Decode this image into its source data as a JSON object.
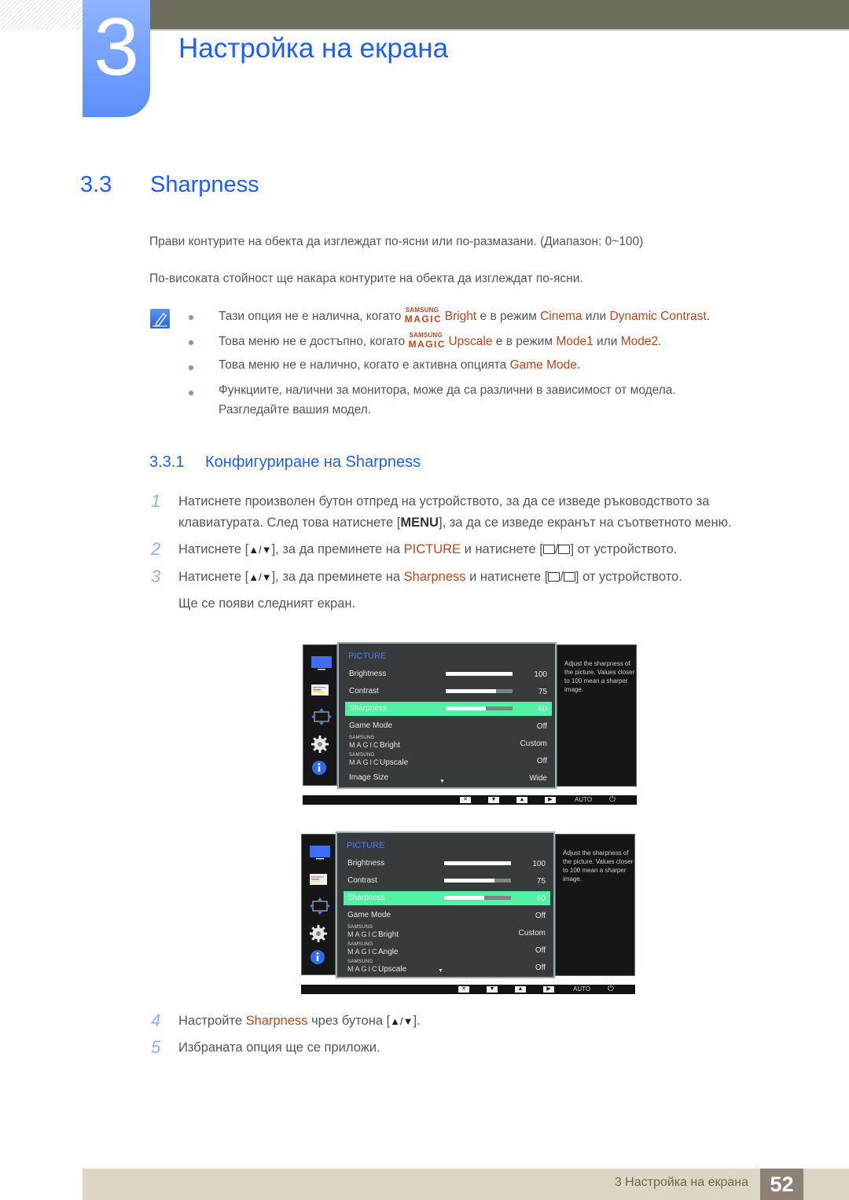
{
  "header": {
    "chapter_number": "3",
    "chapter_title": "Настройка на екрана"
  },
  "section": {
    "number": "3.3",
    "title": "Sharpness"
  },
  "intro": [
    "Прави контурите на обекта да изглеждат по-ясни или по-размазани. (Диапазон: 0~100)",
    "По-високата стойност ще накара контурите на обекта да изглеждат по-ясни."
  ],
  "notes": [
    {
      "pre": "Тази опция не е налична, когато ",
      "magic_top": "SAMSUNG",
      "magic_bottom": "MAGIC",
      "magic_word": "Bright",
      "mid": " е в режим ",
      "hl1": "Cinema",
      "mid2": " или ",
      "hl2": "Dynamic Contrast",
      "post": "."
    },
    {
      "pre": "Това меню не е достъпно, когато ",
      "magic_top": "SAMSUNG",
      "magic_bottom": "MAGIC",
      "magic_word": "Upscale",
      "mid": " е в режим ",
      "hl1": "Mode1",
      "mid2": " или ",
      "hl2": "Mode2",
      "post": "."
    },
    {
      "pre": "Това меню не е налично, когато е активна опцията ",
      "hl1": "Game Mode",
      "post": "."
    },
    {
      "line1": "Функциите, налични за монитора, може да са различни в зависимост от модела.",
      "line2": "Разгледайте вашия модел."
    }
  ],
  "subsection": {
    "number": "3.3.1",
    "title": "Конфигуриране на Sharpness"
  },
  "steps": [
    {
      "num": "1",
      "line1": "Натиснете произволен бутон отпред на устройството, за да се изведе ръководството за",
      "line2_pre": "клавиатурата. След това натиснете [",
      "line2_key": "MENU",
      "line2_post": "], за да се изведе екранът на съответното меню."
    },
    {
      "num": "2",
      "pre": "Натиснете [",
      "arrows": "▲/▼",
      "mid": "], за да преминете на ",
      "hl": "PICTURE",
      "mid2": " и натиснете [",
      "post": "] от устройството."
    },
    {
      "num": "3",
      "pre": "Натиснете [",
      "arrows": "▲/▼",
      "mid": "], за да преминете на ",
      "hl": "Sharpness",
      "mid2": " и натиснете [",
      "post": "] от устройството.",
      "line2": "Ще се появи следният екран."
    },
    {
      "num": "4",
      "pre": "Настройте ",
      "hl": "Sharpness",
      "mid": " чрез бутона [",
      "arrows": "▲/▼",
      "post": "]."
    },
    {
      "num": "5",
      "text": "Избраната опция ще се приложи."
    }
  ],
  "osd_screens": [
    {
      "title": "PICTURE",
      "help": "Adjust the sharpness of the picture. Values closer to 100 mean a sharper image.",
      "rows": [
        {
          "label": "Brightness",
          "value": "100",
          "bar": 1.0
        },
        {
          "label": "Contrast",
          "value": "75",
          "bar": 0.75
        },
        {
          "label": "Sharpness",
          "value": "60",
          "bar": 0.6,
          "selected": true
        },
        {
          "label": "Game Mode",
          "value": "Off"
        },
        {
          "magic": true,
          "magic_top": "SAMSUNG",
          "magic_bottom": "MAGIC",
          "label": "Bright",
          "value": "Custom"
        },
        {
          "magic": true,
          "magic_top": "SAMSUNG",
          "magic_bottom": "MAGIC",
          "label": "Upscale",
          "value": "Off"
        },
        {
          "label": "Image Size",
          "value": "Wide"
        }
      ],
      "buttons": [
        "✕",
        "▼",
        "▲",
        "▶"
      ],
      "auto_label": "AUTO",
      "power_icon": "⏻"
    },
    {
      "title": "PICTURE",
      "help": "Adjust the sharpness of the picture. Values closer to 100 mean a sharper image.",
      "rows": [
        {
          "label": "Brightness",
          "value": "100",
          "bar": 1.0
        },
        {
          "label": "Contrast",
          "value": "75",
          "bar": 0.75
        },
        {
          "label": "Sharpness",
          "value": "60",
          "bar": 0.6,
          "selected": true
        },
        {
          "label": "Game Mode",
          "value": "Off"
        },
        {
          "magic": true,
          "magic_top": "SAMSUNG",
          "magic_bottom": "MAGIC",
          "label": "Bright",
          "value": "Custom"
        },
        {
          "magic": true,
          "magic_top": "SAMSUNG",
          "magic_bottom": "MAGIC",
          "label": "Angle",
          "value": "Off"
        },
        {
          "magic": true,
          "magic_top": "SAMSUNG",
          "magic_bottom": "MAGIC",
          "label": "Upscale",
          "value": "Off"
        }
      ],
      "buttons": [
        "✕",
        "▼",
        "▲",
        "▶"
      ],
      "auto_label": "AUTO",
      "power_icon": "⏻"
    }
  ],
  "footer": {
    "text": "3 Настройка на екрана",
    "page": "52"
  },
  "colors": {
    "accent_blue": "#1f5ff5",
    "highlight_orange": "#c0451b",
    "osd_selected": "#52f1a5",
    "footer_bg": "#dcd7c3",
    "footer_page_bg": "#8c8174"
  }
}
